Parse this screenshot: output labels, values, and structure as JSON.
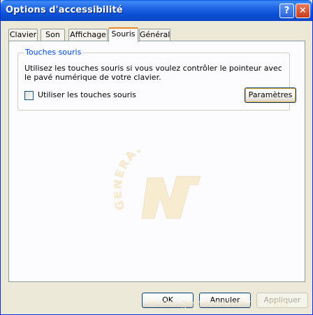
{
  "window": {
    "title": "Options d'accessibilité",
    "help_icon": "question-mark",
    "close_icon": "close-x"
  },
  "tabs": [
    {
      "label": "Clavier",
      "active": false
    },
    {
      "label": "Son",
      "active": false
    },
    {
      "label": "Affichage",
      "active": false
    },
    {
      "label": "Souris",
      "active": true
    },
    {
      "label": "Général",
      "active": false
    }
  ],
  "group": {
    "label": "Touches souris",
    "description": "Utilisez les touches souris si vous voulez contrôler le pointeur avec le pavé numérique de votre clavier.",
    "checkbox_label": "Utiliser les touches souris",
    "checkbox_checked": false,
    "settings_button": "Paramètres"
  },
  "footer": {
    "ok": "OK",
    "cancel": "Annuler",
    "apply": "Appliquer"
  },
  "watermark": {
    "logo_text": "GENERATION NT",
    "site": "www.generation-nt.com"
  },
  "colors": {
    "titlebar": "#0a4fd6",
    "group_label": "#0046d5",
    "tab_accent": "#e68b2c"
  }
}
